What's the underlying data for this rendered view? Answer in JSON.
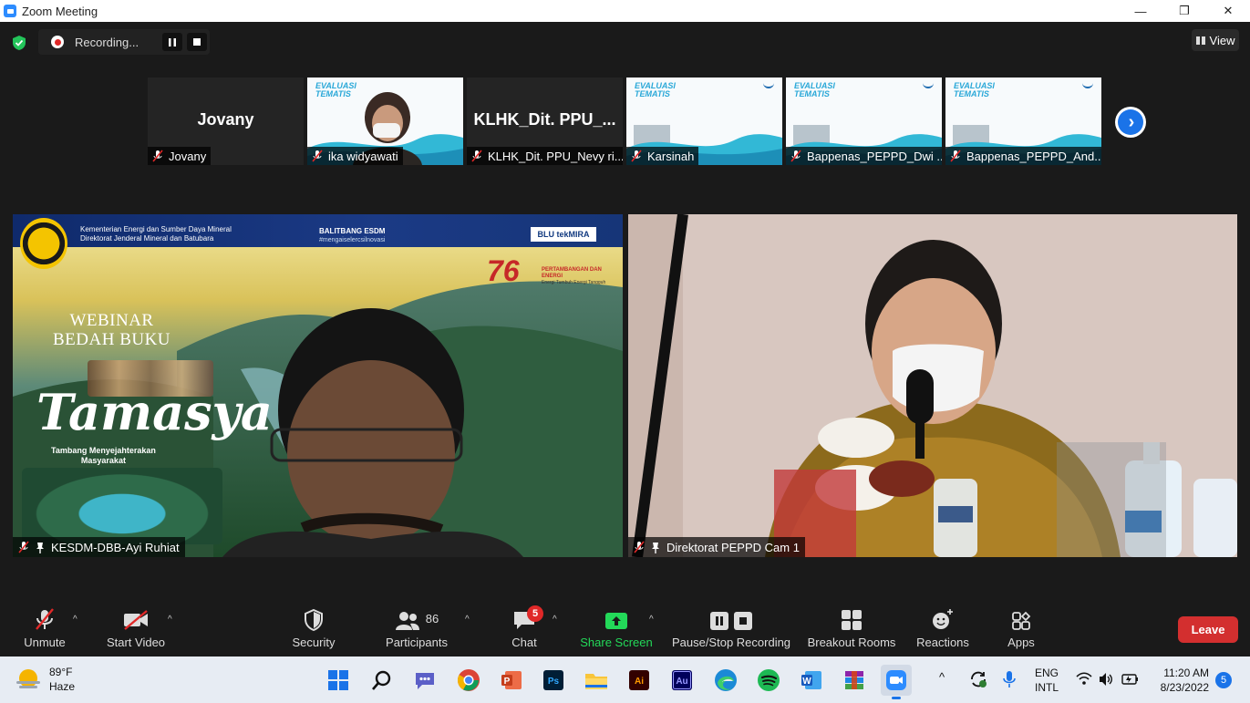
{
  "window": {
    "title": "Zoom Meeting",
    "controls": [
      "—",
      "❐",
      "✕"
    ]
  },
  "recording": {
    "label": "Recording..."
  },
  "view_button": {
    "label": "View"
  },
  "thumbnails": [
    {
      "name": "Jovany",
      "display_name": "Jovany",
      "kind": "name"
    },
    {
      "name": "ika widyawati",
      "kind": "person"
    },
    {
      "name": "KLHK_Dit. PPU_Nevy ri...",
      "display_name": "KLHK_Dit. PPU_...",
      "kind": "name"
    },
    {
      "name": "Karsinah",
      "kind": "slide"
    },
    {
      "name": "Bappenas_PEPPD_Dwi ...",
      "kind": "slide"
    },
    {
      "name": "Bappenas_PEPPD_And...",
      "kind": "slide"
    }
  ],
  "slide_title": [
    "EVALUASI",
    "TEMATIS"
  ],
  "main_videos": {
    "left": {
      "name": "KESDM-DBB-Ayi Ruhiat",
      "banner": {
        "ministry_line1": "Kementerian Energi dan Sumber Daya Mineral",
        "ministry_line2": "Direktorat Jenderal Mineral dan Batubara",
        "balitbang": "BALITBANG ESDM",
        "balitbang_tag": "#mengaiselercsilnovasi",
        "blu": "BLU tekMIRA",
        "anniversary": "76",
        "pertambangan": "PERTAMBANGAN DAN ENERGI",
        "pertambangan_sub": "Energi Tumbuh Energi Tangguh",
        "webinar_line1": "WEBINAR",
        "webinar_line2": "BEDAH BUKU",
        "book_title": "Tamasya",
        "tagline_line1": "Tambang Menyejahterakan",
        "tagline_line2": "Masyarakat"
      }
    },
    "right": {
      "name": "Direktorat PEPPD Cam 1"
    }
  },
  "toolbar": {
    "unmute": "Unmute",
    "start_video": "Start Video",
    "security": "Security",
    "participants": "Participants",
    "participants_count": "86",
    "chat": "Chat",
    "chat_badge": "5",
    "share_screen": "Share Screen",
    "pause_stop_recording": "Pause/Stop Recording",
    "breakout_rooms": "Breakout Rooms",
    "reactions": "Reactions",
    "apps": "Apps",
    "leave": "Leave",
    "colors": {
      "share_green": "#23d959",
      "leave_red": "#d32f2f"
    }
  },
  "taskbar": {
    "weather_temp": "89°F",
    "weather_desc": "Haze",
    "apps": [
      "start-icon",
      "search-icon",
      "teams-chat-icon",
      "chrome-icon",
      "powerpoint-icon",
      "photoshop-icon",
      "file-explorer-icon",
      "illustrator-icon",
      "audition-icon",
      "edge-icon",
      "spotify-icon",
      "word-icon",
      "winrar-icon",
      "zoom-icon"
    ],
    "lang_line1": "ENG",
    "lang_line2": "INTL",
    "time": "11:20 AM",
    "date": "8/23/2022",
    "notifications": "5"
  }
}
